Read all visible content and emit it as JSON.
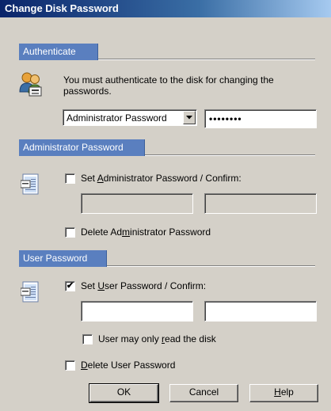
{
  "window": {
    "title": "Change Disk Password"
  },
  "authenticate": {
    "header": "Authenticate",
    "message_line1": "You must authenticate to the disk for changing the",
    "message_line2": "passwords.",
    "password_type": "Administrator Password",
    "password_value": "••••••••"
  },
  "admin": {
    "header": "Administrator Password",
    "set_label_pre": "Set ",
    "set_label_ul": "A",
    "set_label_post": "dministrator Password / Confirm:",
    "set_checked": false,
    "password": "",
    "confirm": "",
    "delete_pre": "Delete Ad",
    "delete_ul": "m",
    "delete_post": "inistrator Password",
    "delete_checked": false
  },
  "user": {
    "header": "User Password",
    "set_pre": "Set ",
    "set_ul": "U",
    "set_post": "ser Password / Confirm:",
    "set_checked": true,
    "checkmark": "✔",
    "password": "",
    "confirm": "",
    "readonly_pre": "User may only ",
    "readonly_ul": "r",
    "readonly_post": "ead the disk",
    "readonly_checked": false,
    "delete_ul": "D",
    "delete_post": "elete User Password",
    "delete_checked": false
  },
  "buttons": {
    "ok": "OK",
    "cancel": "Cancel",
    "help_ul": "H",
    "help_post": "elp"
  },
  "icons": {
    "auth": "users-key-icon",
    "admin": "disk-document-icon",
    "user": "disk-document-icon"
  }
}
